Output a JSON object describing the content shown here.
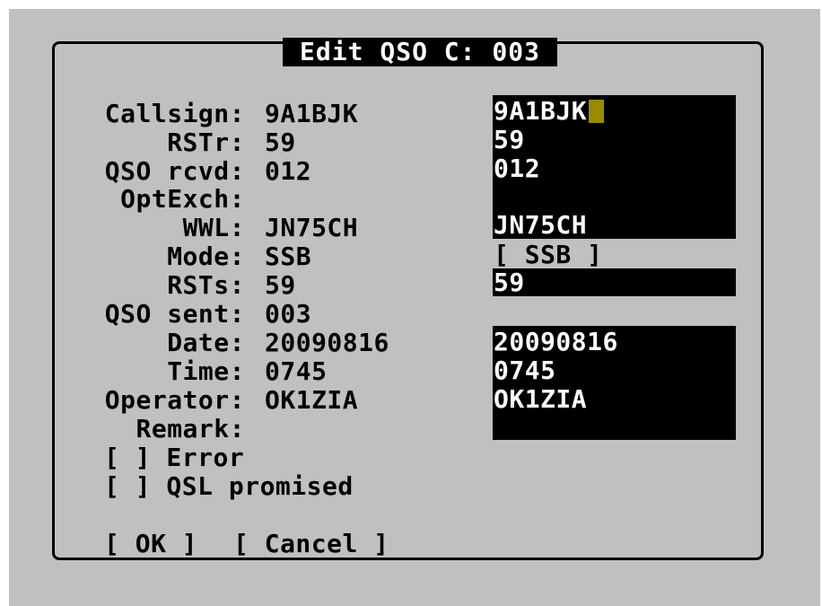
{
  "dialog": {
    "title": " Edit QSO C: 003 "
  },
  "fields": [
    {
      "label": "Callsign:",
      "value": "9A1BJK",
      "input": "9A1BJK"
    },
    {
      "label": "RSTr:",
      "value": "59",
      "input": "59"
    },
    {
      "label": "QSO rcvd:",
      "value": "012",
      "input": "012"
    },
    {
      "label": "OptExch:",
      "value": "",
      "input": ""
    },
    {
      "label": "WWL:",
      "value": "JN75CH",
      "input": "JN75CH"
    },
    {
      "label": "Mode:",
      "value": "SSB",
      "input": "[ SSB ]"
    },
    {
      "label": "RSTs:",
      "value": "59",
      "input": "59"
    },
    {
      "label": "QSO sent:",
      "value": "003",
      "input": ""
    },
    {
      "label": "Date:",
      "value": "20090816",
      "input": "20090816"
    },
    {
      "label": "Time:",
      "value": "0745",
      "input": "0745"
    },
    {
      "label": "Operator:",
      "value": "OK1ZIA",
      "input": "OK1ZIA"
    },
    {
      "label": "Remark:",
      "value": "",
      "input": ""
    }
  ],
  "checkboxes": {
    "error": "[ ] Error",
    "qsl_promised": "[ ] QSL promised"
  },
  "buttons": {
    "ok": "[ OK ]",
    "cancel": "[ Cancel ]"
  },
  "colors": {
    "background": "#c0c0c0",
    "field_background": "#000000",
    "field_text": "#ffffff",
    "cursor": "#9a8a00"
  }
}
